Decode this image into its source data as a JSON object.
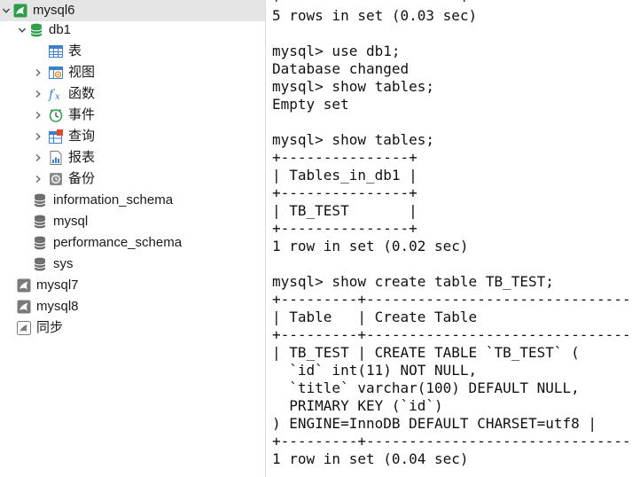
{
  "colors": {
    "selection_bg": "#e5e5e5",
    "db_green": "#2e9d4a",
    "schema_gray": "#6b6b6b",
    "text": "#1a1a1a"
  },
  "tree": {
    "conn_mysql6": {
      "label": "mysql6",
      "icon": "mysql-connection-icon"
    },
    "db1": {
      "label": "db1",
      "icon": "database-icon"
    },
    "db1_children": [
      {
        "label": "表",
        "icon": "table-icon"
      },
      {
        "label": "视图",
        "icon": "view-icon"
      },
      {
        "label": "函数",
        "icon": "function-icon"
      },
      {
        "label": "事件",
        "icon": "event-icon"
      },
      {
        "label": "查询",
        "icon": "query-icon"
      },
      {
        "label": "报表",
        "icon": "report-icon"
      },
      {
        "label": "备份",
        "icon": "backup-icon"
      }
    ],
    "schemas": [
      {
        "label": "information_schema",
        "icon": "database-icon"
      },
      {
        "label": "mysql",
        "icon": "database-icon"
      },
      {
        "label": "performance_schema",
        "icon": "database-icon"
      },
      {
        "label": "sys",
        "icon": "database-icon"
      }
    ],
    "connections": [
      {
        "label": "mysql7",
        "icon": "mysql-connection-icon"
      },
      {
        "label": "mysql8",
        "icon": "mysql-connection-icon"
      },
      {
        "label": "同步",
        "icon": "sync-icon"
      }
    ]
  },
  "console": {
    "lines": [
      "+---------------------+",
      "5 rows in set (0.03 sec)",
      "",
      "mysql> use db1;",
      "Database changed",
      "mysql> show tables;",
      "Empty set",
      "",
      "mysql> show tables;",
      "+---------------+",
      "| Tables_in_db1 |",
      "+---------------+",
      "| TB_TEST       |",
      "+---------------+",
      "1 row in set (0.02 sec)",
      "",
      "mysql> show create table TB_TEST;",
      "+---------+--------------------------------------",
      "| Table   | Create Table",
      "+---------+--------------------------------------",
      "| TB_TEST | CREATE TABLE `TB_TEST` (",
      "  `id` int(11) NOT NULL,",
      "  `title` varchar(100) DEFAULT NULL,",
      "  PRIMARY KEY (`id`)",
      ") ENGINE=InnoDB DEFAULT CHARSET=utf8 |",
      "+---------+--------------------------------------",
      "1 row in set (0.04 sec)"
    ]
  }
}
